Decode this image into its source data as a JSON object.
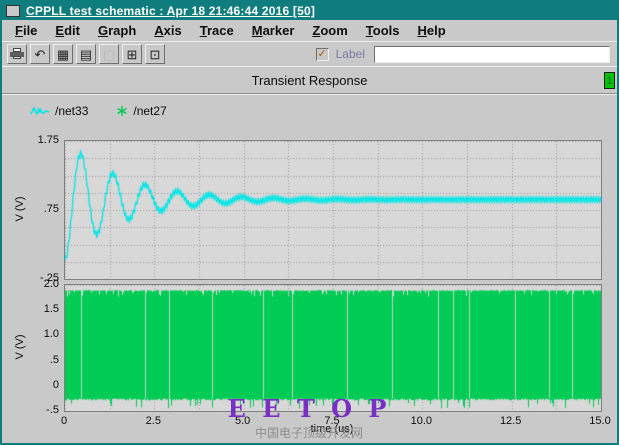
{
  "window": {
    "title": "CPPLL test schematic : Apr 18 21:46:44 2016 [50]"
  },
  "menu": {
    "items": [
      "File",
      "Edit",
      "Graph",
      "Axis",
      "Trace",
      "Marker",
      "Zoom",
      "Tools",
      "Help"
    ]
  },
  "toolbar": {
    "icons": [
      {
        "name": "print-icon",
        "glyph": ""
      },
      {
        "name": "undo-icon",
        "glyph": "↶"
      },
      {
        "name": "grid-icon",
        "glyph": "▦"
      },
      {
        "name": "strip-chart-icon",
        "glyph": "▤"
      },
      {
        "name": "blank-icon",
        "glyph": "▢"
      },
      {
        "name": "split-window-icon",
        "glyph": "⊞"
      },
      {
        "name": "subwindow-icon",
        "glyph": "⊡"
      }
    ],
    "checkbox_glyph": "✓",
    "label_checkbox": "Label",
    "input_value": ""
  },
  "header": {
    "title": "Transient Response",
    "page_badge": "1"
  },
  "legend": [
    {
      "label": "/net33",
      "color": "#00e6e6",
      "marker": "trace"
    },
    {
      "label": "/net27",
      "color": "#00cc55",
      "marker": "asterisk"
    }
  ],
  "colors": {
    "titlebar": "#0f7d7d",
    "plot_background": "#d8d8d8",
    "grid": "#9c9c9c",
    "net33": "#00e6e6",
    "net27": "#00cc55",
    "badge_green": "#00c400"
  },
  "watermark": {
    "text": "E E T O P",
    "subtext": "中国电子顶级开发网"
  },
  "chart_data": [
    {
      "type": "line",
      "name": "/net33",
      "title": "Transient Response",
      "color": "#00e6e6",
      "x_range": [
        0,
        15
      ],
      "y_range": [
        -0.25,
        1.75
      ],
      "y_label": "V (V)",
      "y_tick_values": [
        1.75,
        0.75,
        -0.25
      ],
      "y_tick_labels": [
        "1.75",
        ".75",
        "-.25"
      ],
      "x_grid_step": 1.25,
      "y_grid_step": 0.25,
      "grid": "dotted",
      "model": "damped_oscillation",
      "params": {
        "initial": 0.0,
        "final": 0.9,
        "amplitude": 0.88,
        "tau_us": 1.6,
        "period_us": 0.9,
        "ripple": 0.04,
        "description": "PLL control voltage: starts near 0 V, first overshoot peak ~1.6 V near t~0.5 us, ringing decays and settles to ~0.9 V by ~6 us with small HF ripple band"
      }
    },
    {
      "type": "line",
      "name": "/net27",
      "color": "#00cc55",
      "x_range": [
        0,
        15
      ],
      "y_range": [
        -0.5,
        2.0
      ],
      "y_label": "V (V)",
      "y_tick_values": [
        2.0,
        1.5,
        1.0,
        0.5,
        0.0,
        -0.5
      ],
      "y_tick_labels": [
        "2.0",
        "1.5",
        "1.0",
        ".5",
        "0",
        "-.5"
      ],
      "x_tick_values": [
        0,
        2.5,
        5,
        7.5,
        10,
        12.5,
        15
      ],
      "x_tick_labels": [
        "0",
        "2.5",
        "5.0",
        "7.5",
        "10.0",
        "12.5",
        "15.0"
      ],
      "x_label": "time (us)",
      "x_grid_step": 1.25,
      "y_grid_step": 0.25,
      "grid": "dotted",
      "model": "dense_oscillation",
      "params": {
        "y_low": -0.25,
        "y_high": 1.9,
        "low_spike": -0.45,
        "seed": 7,
        "gap_positions_us": [
          0.45,
          2.25,
          2.9,
          4.1,
          5.55,
          6.35,
          7.9,
          9.15,
          10.45,
          10.85,
          11.3,
          12.6,
          13.55,
          14.2
        ],
        "description": "High-frequency VCO output toggling between ~-0.25 V and ~1.9 V across the full 0-15 us span; renders as a solid green band with occasional thin gaps and downward spikes to ~-0.45 V"
      }
    }
  ]
}
